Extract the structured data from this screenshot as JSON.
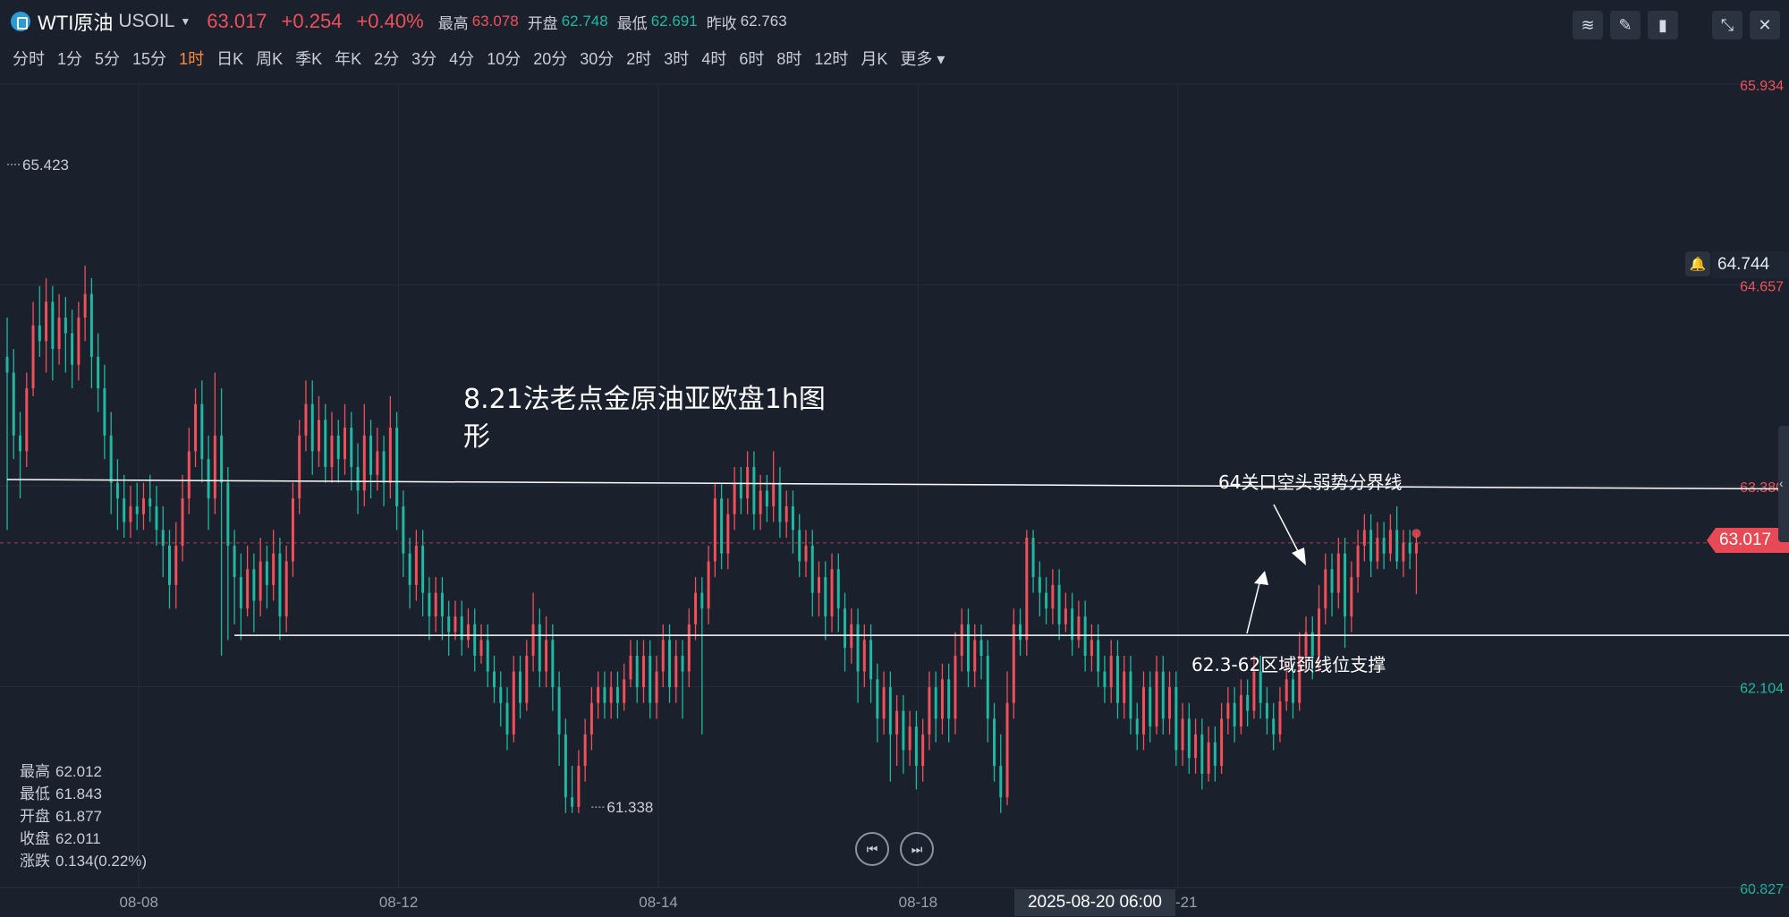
{
  "header": {
    "name": "WTI原油",
    "code": "USOIL",
    "price": "63.017",
    "change": "+0.254",
    "change_pct": "+0.40%",
    "high_label": "最高",
    "high": "63.078",
    "open_label": "开盘",
    "open": "62.748",
    "low_label": "最低",
    "low": "62.691",
    "prev_label": "昨收",
    "prev": "62.763"
  },
  "periods": [
    "分时",
    "1分",
    "5分",
    "15分",
    "1时",
    "日K",
    "周K",
    "季K",
    "年K",
    "2分",
    "3分",
    "4分",
    "10分",
    "20分",
    "30分",
    "2时",
    "3时",
    "4时",
    "6时",
    "8时",
    "12时",
    "月K",
    "更多"
  ],
  "active_period": "1时",
  "ohlc": {
    "high_label": "最高",
    "high": "62.012",
    "low_label": "最低",
    "low": "61.843",
    "open_label": "开盘",
    "open": "61.877",
    "close_label": "收盘",
    "close": "62.011",
    "chg_label": "涨跌",
    "chg": "0.134(0.22%)"
  },
  "alert_price": "64.744",
  "current_price_tag": "63.017",
  "cursor_time": "2025-08-20 06:00",
  "colors": {
    "up": "#f0505a",
    "down": "#1fb8a0",
    "bg": "#1a202c",
    "grid": "#252d3a"
  },
  "chart_data": {
    "type": "candlestick",
    "title": "8.21法老点金原油亚欧盘1h图形",
    "ylim": [
      60.827,
      65.934
    ],
    "y_ticks": [
      {
        "value": 65.934,
        "label": "65.934",
        "color": "#f0505a"
      },
      {
        "value": 64.657,
        "label": "64.657",
        "color": "#f0505a"
      },
      {
        "value": 63.38,
        "label": "63.380",
        "color": "#f0505a"
      },
      {
        "value": 62.104,
        "label": "62.104",
        "color": "#1fb8a0"
      },
      {
        "value": 60.827,
        "label": "60.827",
        "color": "#1fb8a0"
      }
    ],
    "x_ticks": [
      {
        "label": "08-08",
        "index": 20
      },
      {
        "label": "08-12",
        "index": 60
      },
      {
        "label": "08-14",
        "index": 100
      },
      {
        "label": "08-18",
        "index": 140
      },
      {
        "label": "08-21",
        "index": 180
      }
    ],
    "annotations": [
      {
        "type": "line",
        "label": "64关口空头弱势分界线",
        "from": [
          0,
          63.42
        ],
        "to": [
          276,
          63.36
        ]
      },
      {
        "type": "line",
        "label": "62.3-62区域颈线位支撑",
        "from": [
          35,
          62.43
        ],
        "to": [
          276,
          62.43
        ]
      },
      {
        "type": "price_label",
        "label": "65.423",
        "index": 0,
        "value": 65.423
      },
      {
        "type": "price_label",
        "label": "61.338",
        "index": 90,
        "value": 61.338
      }
    ],
    "candles": [
      [
        64.2,
        64.1,
        64.45,
        63.1
      ],
      [
        64.1,
        63.7,
        64.25,
        63.55
      ],
      [
        63.7,
        63.6,
        63.85,
        63.3
      ],
      [
        63.6,
        64.0,
        64.1,
        63.5
      ],
      [
        64.0,
        64.4,
        64.55,
        63.95
      ],
      [
        64.4,
        64.3,
        64.65,
        64.2
      ],
      [
        64.3,
        64.55,
        64.7,
        64.1
      ],
      [
        64.55,
        64.25,
        64.65,
        64.05
      ],
      [
        64.25,
        64.45,
        64.6,
        64.15
      ],
      [
        64.45,
        64.35,
        64.58,
        64.1
      ],
      [
        64.35,
        64.15,
        64.5,
        64.0
      ],
      [
        64.15,
        64.45,
        64.55,
        64.05
      ],
      [
        64.45,
        64.6,
        64.78,
        64.3
      ],
      [
        64.6,
        64.2,
        64.7,
        64.0
      ],
      [
        64.2,
        64.0,
        64.35,
        63.85
      ],
      [
        64.0,
        63.7,
        64.15,
        63.55
      ],
      [
        63.7,
        63.4,
        63.85,
        63.2
      ],
      [
        63.4,
        63.3,
        63.55,
        63.1
      ],
      [
        63.3,
        63.15,
        63.45,
        63.05
      ],
      [
        63.15,
        63.25,
        63.38,
        63.05
      ],
      [
        63.25,
        63.2,
        63.4,
        63.1
      ],
      [
        63.2,
        63.3,
        63.4,
        63.1
      ],
      [
        63.3,
        63.25,
        63.45,
        63.15
      ],
      [
        63.25,
        63.1,
        63.38,
        63.0
      ],
      [
        63.1,
        63.0,
        63.25,
        62.8
      ],
      [
        63.0,
        62.75,
        63.1,
        62.6
      ],
      [
        62.75,
        63.0,
        63.15,
        62.6
      ],
      [
        63.0,
        63.3,
        63.45,
        62.9
      ],
      [
        63.3,
        63.6,
        63.75,
        63.2
      ],
      [
        63.6,
        63.9,
        64.0,
        63.5
      ],
      [
        63.9,
        63.55,
        64.05,
        63.4
      ],
      [
        63.55,
        63.3,
        63.7,
        63.1
      ],
      [
        63.3,
        63.7,
        64.1,
        63.2
      ],
      [
        63.7,
        63.4,
        64.0,
        62.3
      ],
      [
        63.4,
        63.0,
        63.5,
        62.4
      ],
      [
        63.0,
        62.8,
        63.1,
        62.5
      ],
      [
        62.8,
        62.6,
        62.95,
        62.4
      ],
      [
        62.6,
        62.85,
        63.0,
        62.55
      ],
      [
        62.85,
        62.65,
        62.95,
        62.45
      ],
      [
        62.65,
        62.9,
        63.05,
        62.55
      ],
      [
        62.9,
        62.75,
        63.0,
        62.6
      ],
      [
        62.75,
        62.95,
        63.1,
        62.65
      ],
      [
        62.95,
        62.55,
        63.05,
        62.4
      ],
      [
        62.55,
        62.9,
        63.0,
        62.45
      ],
      [
        62.9,
        63.3,
        63.4,
        62.8
      ],
      [
        63.3,
        63.7,
        63.8,
        63.2
      ],
      [
        63.7,
        63.9,
        64.05,
        63.6
      ],
      [
        63.9,
        63.6,
        64.05,
        63.45
      ],
      [
        63.6,
        63.8,
        63.95,
        63.5
      ],
      [
        63.8,
        63.5,
        63.9,
        63.4
      ],
      [
        63.5,
        63.7,
        63.85,
        63.4
      ],
      [
        63.7,
        63.55,
        63.8,
        63.4
      ],
      [
        63.55,
        63.75,
        63.9,
        63.45
      ],
      [
        63.75,
        63.5,
        63.85,
        63.35
      ],
      [
        63.5,
        63.35,
        63.65,
        63.2
      ],
      [
        63.35,
        63.7,
        63.9,
        63.25
      ],
      [
        63.7,
        63.45,
        63.8,
        63.3
      ],
      [
        63.45,
        63.6,
        63.75,
        63.35
      ],
      [
        63.6,
        63.4,
        63.7,
        63.25
      ],
      [
        63.4,
        63.75,
        63.95,
        63.3
      ],
      [
        63.75,
        63.25,
        63.85,
        63.1
      ],
      [
        63.25,
        62.95,
        63.35,
        62.8
      ],
      [
        62.95,
        62.75,
        63.05,
        62.6
      ],
      [
        62.75,
        63.0,
        63.1,
        62.65
      ],
      [
        63.0,
        62.7,
        63.1,
        62.55
      ],
      [
        62.7,
        62.55,
        62.8,
        62.4
      ],
      [
        62.55,
        62.7,
        62.8,
        62.45
      ],
      [
        62.7,
        62.55,
        62.8,
        62.4
      ],
      [
        62.55,
        62.45,
        62.65,
        62.3
      ],
      [
        62.45,
        62.55,
        62.65,
        62.4
      ],
      [
        62.55,
        62.4,
        62.65,
        62.3
      ],
      [
        62.4,
        62.5,
        62.6,
        62.35
      ],
      [
        62.5,
        62.3,
        62.6,
        62.2
      ],
      [
        62.3,
        62.4,
        62.5,
        62.25
      ],
      [
        62.4,
        62.2,
        62.5,
        62.1
      ],
      [
        62.2,
        62.1,
        62.3,
        62.0
      ],
      [
        62.1,
        62.0,
        62.2,
        61.85
      ],
      [
        62.0,
        61.8,
        62.1,
        61.7
      ],
      [
        61.8,
        62.2,
        62.3,
        61.75
      ],
      [
        62.2,
        62.0,
        62.3,
        61.9
      ],
      [
        62.0,
        62.3,
        62.4,
        61.95
      ],
      [
        62.3,
        62.5,
        62.7,
        62.2
      ],
      [
        62.5,
        62.2,
        62.6,
        62.1
      ],
      [
        62.2,
        62.4,
        62.55,
        62.1
      ],
      [
        62.4,
        62.1,
        62.5,
        61.95
      ],
      [
        62.1,
        61.8,
        62.2,
        61.6
      ],
      [
        61.8,
        61.4,
        61.9,
        61.3
      ],
      [
        61.4,
        61.34,
        61.6,
        61.3
      ],
      [
        61.34,
        61.6,
        61.7,
        61.3
      ],
      [
        61.6,
        61.8,
        61.9,
        61.5
      ],
      [
        61.8,
        62.0,
        62.1,
        61.7
      ],
      [
        62.0,
        62.1,
        62.2,
        61.9
      ],
      [
        62.1,
        62.0,
        62.2,
        61.9
      ],
      [
        62.0,
        62.1,
        62.2,
        61.9
      ],
      [
        62.1,
        62.0,
        62.2,
        61.9
      ],
      [
        62.0,
        62.15,
        62.25,
        61.95
      ],
      [
        62.15,
        62.3,
        62.4,
        62.1
      ],
      [
        62.3,
        62.1,
        62.4,
        62.0
      ],
      [
        62.1,
        62.3,
        62.4,
        62.0
      ],
      [
        62.3,
        62.0,
        62.4,
        61.9
      ],
      [
        62.0,
        62.2,
        62.3,
        61.9
      ],
      [
        62.2,
        62.4,
        62.5,
        62.1
      ],
      [
        62.4,
        62.1,
        62.5,
        62.0
      ],
      [
        62.1,
        62.3,
        62.4,
        62.0
      ],
      [
        62.3,
        62.2,
        62.4,
        61.9
      ],
      [
        62.2,
        62.5,
        62.6,
        62.1
      ],
      [
        62.5,
        62.7,
        62.8,
        62.4
      ],
      [
        62.7,
        62.6,
        62.8,
        61.8
      ],
      [
        62.6,
        62.9,
        63.0,
        62.5
      ],
      [
        62.9,
        63.3,
        63.4,
        62.8
      ],
      [
        63.3,
        62.95,
        63.4,
        62.85
      ],
      [
        62.95,
        63.2,
        63.3,
        62.85
      ],
      [
        63.2,
        63.4,
        63.5,
        63.1
      ],
      [
        63.4,
        63.3,
        63.5,
        63.2
      ],
      [
        63.3,
        63.5,
        63.6,
        63.2
      ],
      [
        63.5,
        63.2,
        63.6,
        63.1
      ],
      [
        63.2,
        63.35,
        63.45,
        63.1
      ],
      [
        63.35,
        63.25,
        63.45,
        63.15
      ],
      [
        63.25,
        63.4,
        63.6,
        63.15
      ],
      [
        63.4,
        63.15,
        63.5,
        63.05
      ],
      [
        63.15,
        63.25,
        63.35,
        63.05
      ],
      [
        63.25,
        63.1,
        63.35,
        62.95
      ],
      [
        63.1,
        62.9,
        63.2,
        62.8
      ],
      [
        62.9,
        63.0,
        63.1,
        62.8
      ],
      [
        63.0,
        62.7,
        63.1,
        62.55
      ],
      [
        62.7,
        62.8,
        62.9,
        62.55
      ],
      [
        62.8,
        62.55,
        62.9,
        62.4
      ],
      [
        62.55,
        62.85,
        62.95,
        62.45
      ],
      [
        62.85,
        62.6,
        62.95,
        62.45
      ],
      [
        62.6,
        62.35,
        62.7,
        62.2
      ],
      [
        62.35,
        62.5,
        62.6,
        62.25
      ],
      [
        62.5,
        62.2,
        62.6,
        62.0
      ],
      [
        62.2,
        62.4,
        62.5,
        62.1
      ],
      [
        62.4,
        62.15,
        62.5,
        62.0
      ],
      [
        62.15,
        61.9,
        62.25,
        61.75
      ],
      [
        61.9,
        62.1,
        62.2,
        61.8
      ],
      [
        62.1,
        61.8,
        62.2,
        61.5
      ],
      [
        61.8,
        61.95,
        62.05,
        61.6
      ],
      [
        61.95,
        61.7,
        62.05,
        61.55
      ],
      [
        61.7,
        61.85,
        61.95,
        61.6
      ],
      [
        61.85,
        61.6,
        61.95,
        61.45
      ],
      [
        61.6,
        61.8,
        61.9,
        61.5
      ],
      [
        61.8,
        62.1,
        62.2,
        61.7
      ],
      [
        62.1,
        61.9,
        62.2,
        61.75
      ],
      [
        61.9,
        62.15,
        62.25,
        61.8
      ],
      [
        62.15,
        61.9,
        62.25,
        61.75
      ],
      [
        61.9,
        62.3,
        62.45,
        61.8
      ],
      [
        62.3,
        62.5,
        62.6,
        62.2
      ],
      [
        62.5,
        62.2,
        62.6,
        62.1
      ],
      [
        62.2,
        62.4,
        62.5,
        62.1
      ],
      [
        62.4,
        62.3,
        62.5,
        62.15
      ],
      [
        62.3,
        61.9,
        62.4,
        61.75
      ],
      [
        61.9,
        61.6,
        62.0,
        61.5
      ],
      [
        61.6,
        61.4,
        61.8,
        61.3
      ],
      [
        61.4,
        62.0,
        62.2,
        61.35
      ],
      [
        62.0,
        62.5,
        62.6,
        61.9
      ],
      [
        62.5,
        62.4,
        62.6,
        62.3
      ],
      [
        62.4,
        63.05,
        63.1,
        62.3
      ],
      [
        63.05,
        62.8,
        63.1,
        62.7
      ],
      [
        62.8,
        62.7,
        62.9,
        62.55
      ],
      [
        62.7,
        62.6,
        62.8,
        62.5
      ],
      [
        62.6,
        62.75,
        62.85,
        62.5
      ],
      [
        62.75,
        62.5,
        62.85,
        62.4
      ],
      [
        62.5,
        62.6,
        62.7,
        62.45
      ],
      [
        62.6,
        62.4,
        62.7,
        62.3
      ],
      [
        62.4,
        62.55,
        62.65,
        62.35
      ],
      [
        62.55,
        62.3,
        62.65,
        62.2
      ],
      [
        62.3,
        62.4,
        62.5,
        62.2
      ],
      [
        62.4,
        62.2,
        62.5,
        62.1
      ],
      [
        62.2,
        62.1,
        62.3,
        62.0
      ],
      [
        62.1,
        62.3,
        62.4,
        62.0
      ],
      [
        62.3,
        62.0,
        62.4,
        61.9
      ],
      [
        62.0,
        62.2,
        62.3,
        61.9
      ],
      [
        62.2,
        61.9,
        62.3,
        61.8
      ],
      [
        61.9,
        61.8,
        62.0,
        61.7
      ],
      [
        61.8,
        62.1,
        62.2,
        61.7
      ],
      [
        62.1,
        61.85,
        62.2,
        61.75
      ],
      [
        61.85,
        62.2,
        62.3,
        61.8
      ],
      [
        62.2,
        61.9,
        62.3,
        61.8
      ],
      [
        61.9,
        62.1,
        62.2,
        61.8
      ],
      [
        62.1,
        61.7,
        62.2,
        61.6
      ],
      [
        61.7,
        61.9,
        62.0,
        61.6
      ],
      [
        61.9,
        61.65,
        62.0,
        61.55
      ],
      [
        61.65,
        61.8,
        61.9,
        61.55
      ],
      [
        61.8,
        61.55,
        61.9,
        61.45
      ],
      [
        61.55,
        61.75,
        61.85,
        61.5
      ],
      [
        61.75,
        61.6,
        61.85,
        61.5
      ],
      [
        61.6,
        61.9,
        62.0,
        61.55
      ],
      [
        61.9,
        62.0,
        62.1,
        61.8
      ],
      [
        62.0,
        61.85,
        62.1,
        61.75
      ],
      [
        61.85,
        62.05,
        62.15,
        61.8
      ],
      [
        62.05,
        61.95,
        62.15,
        61.85
      ],
      [
        61.95,
        62.2,
        62.3,
        61.9
      ],
      [
        62.2,
        62.0,
        62.3,
        61.9
      ],
      [
        62.0,
        61.9,
        62.1,
        61.8
      ],
      [
        61.9,
        61.8,
        62.0,
        61.7
      ],
      [
        61.8,
        62.01,
        62.1,
        61.75
      ],
      [
        62.01,
        62.15,
        62.25,
        61.95
      ],
      [
        62.15,
        62.0,
        62.25,
        61.9
      ],
      [
        62.0,
        62.3,
        62.45,
        61.95
      ],
      [
        62.3,
        62.45,
        62.55,
        62.2
      ],
      [
        62.45,
        62.3,
        62.55,
        62.15
      ],
      [
        62.3,
        62.6,
        62.75,
        62.2
      ],
      [
        62.6,
        62.85,
        62.95,
        62.5
      ],
      [
        62.85,
        62.7,
        62.95,
        62.55
      ],
      [
        62.7,
        62.95,
        63.05,
        62.6
      ],
      [
        62.95,
        62.55,
        63.05,
        62.35
      ],
      [
        62.55,
        62.8,
        62.9,
        62.45
      ],
      [
        62.8,
        63.0,
        63.1,
        62.7
      ],
      [
        63.0,
        63.1,
        63.2,
        62.9
      ],
      [
        63.1,
        62.9,
        63.2,
        62.8
      ],
      [
        62.9,
        63.05,
        63.15,
        62.85
      ],
      [
        63.05,
        62.95,
        63.15,
        62.85
      ],
      [
        62.95,
        63.1,
        63.2,
        62.9
      ],
      [
        63.1,
        62.9,
        63.25,
        62.85
      ],
      [
        62.9,
        63.02,
        63.1,
        62.8
      ],
      [
        63.02,
        62.95,
        63.1,
        62.85
      ],
      [
        62.95,
        63.017,
        63.078,
        62.691
      ]
    ]
  }
}
